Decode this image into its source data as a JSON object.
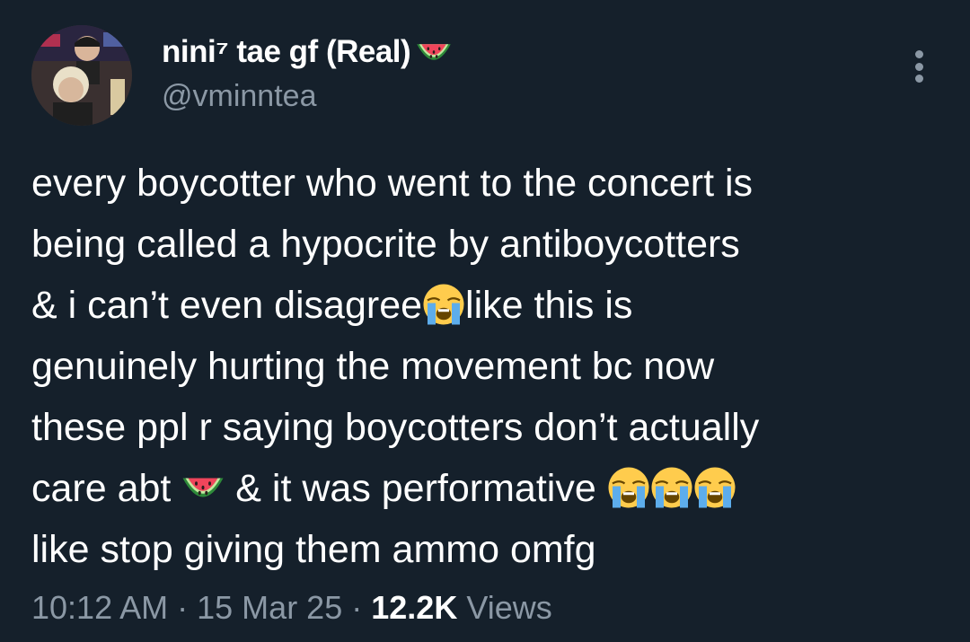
{
  "author": {
    "display_name": "nini⁷ tae gf (Real)",
    "name_emoji": "watermelon",
    "handle": "@vminntea"
  },
  "tweet": {
    "lines": [
      {
        "text": "every boycotter who went to the concert is"
      },
      {
        "text": "being called a hypocrite by antiboycotters"
      },
      {
        "before": "& i can’t even disagree",
        "after": "like this is"
      },
      {
        "text": "genuinely hurting the movement bc now"
      },
      {
        "text": "these ppl r saying boycotters don’t actually"
      },
      {
        "before": "care abt ",
        "after": " & it was performative "
      },
      {
        "text": "like stop giving them ammo omfg"
      }
    ],
    "emojis": {
      "crying": "loudly-crying-face",
      "melon": "watermelon"
    }
  },
  "meta": {
    "time": "10:12 AM",
    "sep": "·",
    "date": "15 Mar 25",
    "views_count": "12.2K",
    "views_label": "Views"
  },
  "colors": {
    "background": "#15202b",
    "text": "#ffffff",
    "muted": "#8b98a5"
  },
  "icons": {
    "more": "more-options-icon"
  }
}
